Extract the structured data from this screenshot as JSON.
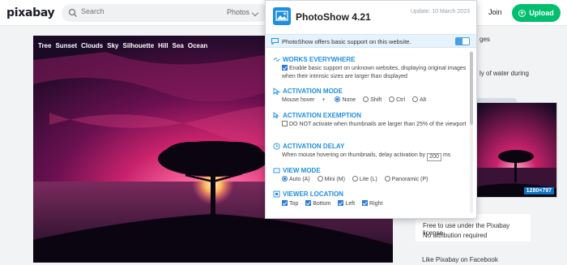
{
  "header": {
    "logo": "pixabay",
    "search_placeholder": "Search",
    "search_filter": "Photos",
    "join_label": "Join",
    "upload_label": "Upload"
  },
  "image": {
    "tags": [
      "Tree",
      "Sunset",
      "Clouds",
      "Sky",
      "Silhouette",
      "Hill",
      "Sea",
      "Ocean"
    ]
  },
  "sidebar": {
    "text_top": "ges",
    "text_mid1": "ly of water during",
    "text_mid2": "",
    "thumb_badge": "1280×797",
    "license_line1": "Free to use under the Pixabay license",
    "license_line2": "No attribution required",
    "facebook": "Like Pixabay on Facebook"
  },
  "popup": {
    "title": "PhotoShow 4.21",
    "update": "Update: 10 March 2023",
    "notice": "PhotoShow offers basic support on this website.",
    "sections": {
      "works": {
        "title": "WORKS EVERYWHERE",
        "text": "Enable basic support on unknown websites, displaying original images when their intrinsic sizes are larger than displayed"
      },
      "activation": {
        "title": "ACTIVATION MODE",
        "prefix": "Mouse hover",
        "plus": "+",
        "options": [
          "None",
          "Shift",
          "Ctrl",
          "Alt"
        ]
      },
      "exemption": {
        "title": "ACTIVATION EXEMPTION",
        "text": "DO NOT activate when thumbnails are larger than 25% of the viewport"
      },
      "delay": {
        "title": "ACTIVATION DELAY",
        "text": "When mouse hovering on thumbnails, delay activation by",
        "value": "200",
        "unit": "ms"
      },
      "view": {
        "title": "VIEW MODE",
        "options": [
          "Auto (A)",
          "Mini (M)",
          "Lite (L)",
          "Panoramic (P)"
        ]
      },
      "location": {
        "title": "VIEWER LOCATION",
        "options": [
          "Top",
          "Bottom",
          "Left",
          "Right"
        ]
      }
    }
  },
  "colors": {
    "accent": "#1e8fe0",
    "upload": "#02be6e",
    "notice_bg": "#e6f2fc"
  }
}
